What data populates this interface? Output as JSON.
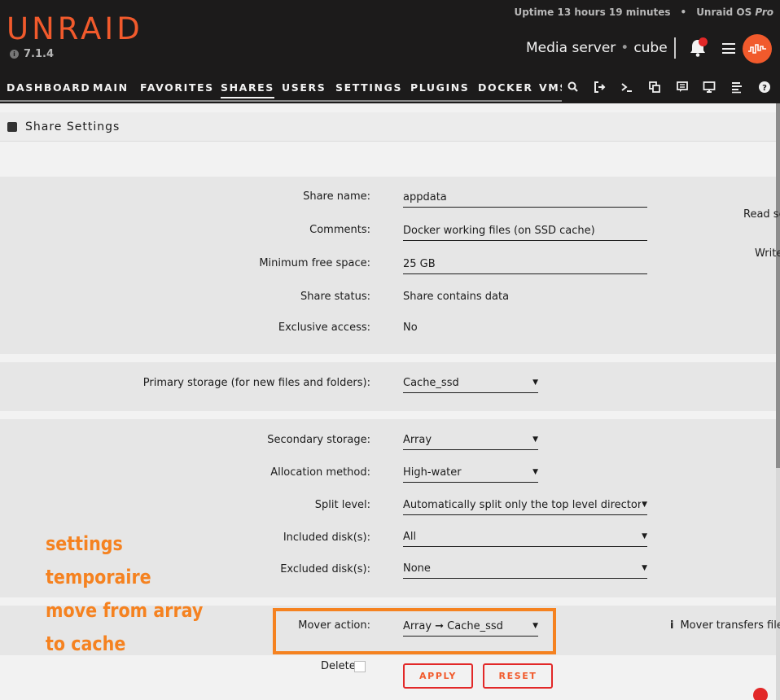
{
  "header": {
    "logo": "UNRAID",
    "version": "7.1.4",
    "uptime": "Uptime 13 hours 19 minutes",
    "os_label": "Unraid OS",
    "os_edition": "Pro",
    "server_name": "Media server",
    "server_desc": "cube"
  },
  "nav": {
    "items": [
      "DASHBOARD",
      "MAIN",
      "FAVORITES",
      "SHARES",
      "USERS",
      "SETTINGS",
      "PLUGINS",
      "DOCKER",
      "VMS"
    ],
    "active": "SHARES",
    "icons": [
      "search-icon",
      "logout-icon",
      "terminal-icon",
      "copy-icon",
      "feedback-icon",
      "monitor-icon",
      "log-icon",
      "help-icon"
    ]
  },
  "page": {
    "title": "Share Settings"
  },
  "form": {
    "share_name_label": "Share name:",
    "share_name_value": "appdata",
    "comments_label": "Comments:",
    "comments_value": "Docker working files (on SSD cache)",
    "min_free_label": "Minimum free space:",
    "min_free_value": "25 GB",
    "share_status_label": "Share status:",
    "share_status_value": "Share contains data",
    "exclusive_label": "Exclusive access:",
    "exclusive_value": "No",
    "primary_label": "Primary storage (for new files and folders):",
    "primary_value": "Cache_ssd",
    "secondary_label": "Secondary storage:",
    "secondary_value": "Array",
    "allocation_label": "Allocation method:",
    "allocation_value": "High-water",
    "split_label": "Split level:",
    "split_value": "Automatically split only the top level directory as r",
    "included_label": "Included disk(s):",
    "included_value": "All",
    "excluded_label": "Excluded disk(s):",
    "excluded_value": "None",
    "mover_label": "Mover action:",
    "mover_value": "Array ➞ Cache_ssd",
    "mover_info": "Mover transfers files",
    "delete_label": "Delete",
    "apply_label": "APPLY",
    "reset_label": "RESET",
    "read_side": "Read se",
    "write_side": "Write"
  },
  "annotation": {
    "lines": [
      "settings",
      "temporaire",
      "move from array",
      "to cache"
    ],
    "color": "#f58220"
  },
  "colors": {
    "accent": "#f15a2c",
    "header_bg": "#1c1b1b"
  }
}
